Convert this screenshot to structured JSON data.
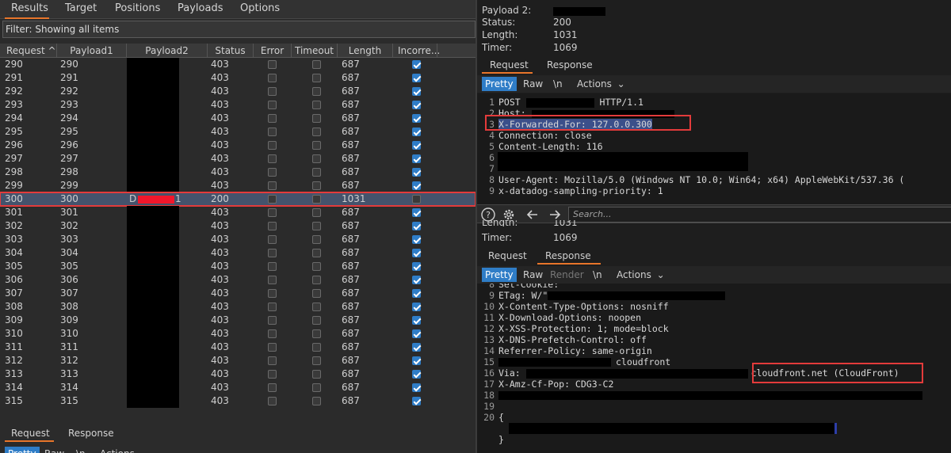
{
  "main_tabs": [
    "Results",
    "Target",
    "Positions",
    "Payloads",
    "Options"
  ],
  "filter_text": "Filter: Showing all items",
  "columns": [
    "Request ^",
    "Payload1",
    "Payload2",
    "Status",
    "Error",
    "Timeout",
    "Length",
    "Incorre..."
  ],
  "rows": [
    {
      "req": "290",
      "p1": "290",
      "p2": "",
      "status": "403",
      "len": "687",
      "incorrect": true
    },
    {
      "req": "291",
      "p1": "291",
      "p2": "",
      "status": "403",
      "len": "687",
      "incorrect": true
    },
    {
      "req": "292",
      "p1": "292",
      "p2": "",
      "status": "403",
      "len": "687",
      "incorrect": true
    },
    {
      "req": "293",
      "p1": "293",
      "p2": "",
      "status": "403",
      "len": "687",
      "incorrect": true
    },
    {
      "req": "294",
      "p1": "294",
      "p2": "",
      "status": "403",
      "len": "687",
      "incorrect": true
    },
    {
      "req": "295",
      "p1": "295",
      "p2": "",
      "status": "403",
      "len": "687",
      "incorrect": true
    },
    {
      "req": "296",
      "p1": "296",
      "p2": "",
      "status": "403",
      "len": "687",
      "incorrect": true
    },
    {
      "req": "297",
      "p1": "297",
      "p2": "",
      "status": "403",
      "len": "687",
      "incorrect": true
    },
    {
      "req": "298",
      "p1": "298",
      "p2": "",
      "status": "403",
      "len": "687",
      "incorrect": true
    },
    {
      "req": "299",
      "p1": "299",
      "p2": "",
      "status": "403",
      "len": "687",
      "incorrect": true
    },
    {
      "req": "300",
      "p1": "300",
      "p2": "D",
      "p2_tail": "1",
      "status": "200",
      "len": "1031",
      "incorrect": false,
      "selected": true
    },
    {
      "req": "301",
      "p1": "301",
      "p2": "",
      "status": "403",
      "len": "687",
      "incorrect": true
    },
    {
      "req": "302",
      "p1": "302",
      "p2": "",
      "status": "403",
      "len": "687",
      "incorrect": true
    },
    {
      "req": "303",
      "p1": "303",
      "p2": "",
      "status": "403",
      "len": "687",
      "incorrect": true
    },
    {
      "req": "304",
      "p1": "304",
      "p2": "",
      "status": "403",
      "len": "687",
      "incorrect": true
    },
    {
      "req": "305",
      "p1": "305",
      "p2": "",
      "status": "403",
      "len": "687",
      "incorrect": true
    },
    {
      "req": "306",
      "p1": "306",
      "p2": "",
      "status": "403",
      "len": "687",
      "incorrect": true
    },
    {
      "req": "307",
      "p1": "307",
      "p2": "",
      "status": "403",
      "len": "687",
      "incorrect": true
    },
    {
      "req": "308",
      "p1": "308",
      "p2": "",
      "status": "403",
      "len": "687",
      "incorrect": true
    },
    {
      "req": "309",
      "p1": "309",
      "p2": "",
      "status": "403",
      "len": "687",
      "incorrect": true
    },
    {
      "req": "310",
      "p1": "310",
      "p2": "",
      "status": "403",
      "len": "687",
      "incorrect": true
    },
    {
      "req": "311",
      "p1": "311",
      "p2": "",
      "status": "403",
      "len": "687",
      "incorrect": true
    },
    {
      "req": "312",
      "p1": "312",
      "p2": "",
      "status": "403",
      "len": "687",
      "incorrect": true
    },
    {
      "req": "313",
      "p1": "313",
      "p2": "",
      "status": "403",
      "len": "687",
      "incorrect": true
    },
    {
      "req": "314",
      "p1": "314",
      "p2": "",
      "status": "403",
      "len": "687",
      "incorrect": true
    },
    {
      "req": "315",
      "p1": "315",
      "p2": "",
      "status": "403",
      "len": "687",
      "incorrect": true
    }
  ],
  "left_bottom_tabs": [
    "Request",
    "Response"
  ],
  "left_bottom_tools": [
    "Pretty",
    "Raw",
    "\\n",
    "Actions"
  ],
  "top_meta": [
    {
      "label": "Payload 2:",
      "value": ""
    },
    {
      "label": "Status:",
      "value": "200"
    },
    {
      "label": "Length:",
      "value": "1031"
    },
    {
      "label": "Timer:",
      "value": "1069"
    }
  ],
  "req_tabs": [
    "Request",
    "Response"
  ],
  "req_tools": [
    "Pretty",
    "Raw",
    "\\n",
    "Actions"
  ],
  "request_lines": [
    {
      "n": "1",
      "text": "POST ",
      "tail": " HTTP/1.1"
    },
    {
      "n": "2",
      "text": "Host: "
    },
    {
      "n": "3",
      "text": "X-Forwarded-For: 127.0.0.300"
    },
    {
      "n": "4",
      "text": "Connection: close"
    },
    {
      "n": "5",
      "text": "Content-Length: 116"
    },
    {
      "n": "6",
      "text": ""
    },
    {
      "n": "7",
      "text": ""
    },
    {
      "n": "8",
      "text": "User-Agent: Mozilla/5.0 (Windows NT 10.0; Win64; x64) AppleWebKit/537.36 ("
    },
    {
      "n": "9",
      "text": "x-datadog-sampling-priority: 1"
    }
  ],
  "search_placeholder": "Search...",
  "mid_meta": [
    {
      "label": "Length:",
      "value": "1031"
    },
    {
      "label": "Timer:",
      "value": "1069"
    }
  ],
  "resp_tabs": [
    "Request",
    "Response"
  ],
  "resp_tools": [
    "Pretty",
    "Raw",
    "Render",
    "\\n",
    "Actions"
  ],
  "response_lines": [
    {
      "n": "8",
      "text": "Set-Cookie: "
    },
    {
      "n": "9",
      "text": "ETag: W/\""
    },
    {
      "n": "10",
      "text": "X-Content-Type-Options: nosniff"
    },
    {
      "n": "11",
      "text": "X-Download-Options: noopen"
    },
    {
      "n": "12",
      "text": "X-XSS-Protection: 1; mode=block"
    },
    {
      "n": "13",
      "text": "X-DNS-Prefetch-Control: off"
    },
    {
      "n": "14",
      "text": "Referrer-Policy: same-origin"
    },
    {
      "n": "15",
      "text": "",
      "tail": "cloudfront"
    },
    {
      "n": "16",
      "text": "Via: ",
      "tail": "cloudfront.net (CloudFront)"
    },
    {
      "n": "17",
      "text": "X-Amz-Cf-Pop: CDG3-C2"
    },
    {
      "n": "18",
      "text": ""
    },
    {
      "n": "19",
      "text": ""
    },
    {
      "n": "20",
      "text": "{"
    },
    {
      "n": "",
      "text": ""
    },
    {
      "n": "",
      "text": "}"
    }
  ],
  "colors": {
    "accent": "#e8752a",
    "highlight": "#e33b3b",
    "button_active": "#2f7dc7"
  }
}
